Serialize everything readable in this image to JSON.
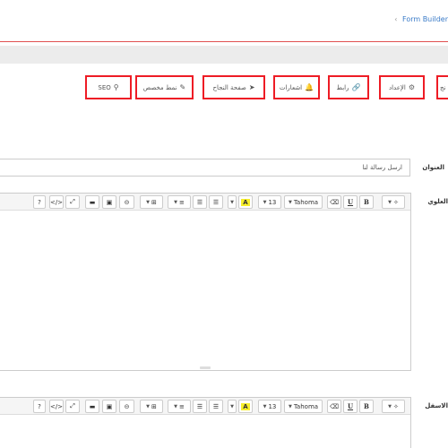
{
  "breadcrumb": {
    "separator": "‹",
    "link": "Form Builder"
  },
  "tabs": [
    {
      "key": "seo",
      "label": "SEO",
      "icon": "search-icon",
      "glyph": "⚲"
    },
    {
      "key": "custom-style",
      "label": "نمط مخصص",
      "icon": "pencil-icon",
      "glyph": "✎"
    },
    {
      "key": "success-page",
      "label": "صفحة النجاح",
      "icon": "send-icon",
      "glyph": "➤"
    },
    {
      "key": "notifications",
      "label": "اشعارات",
      "icon": "bell-icon",
      "glyph": "🔔"
    },
    {
      "key": "link",
      "label": "رابط",
      "icon": "link-icon",
      "glyph": "🔗"
    },
    {
      "key": "settings",
      "label": "الإعداد",
      "icon": "gears-icon",
      "glyph": "⚙"
    },
    {
      "key": "cut",
      "label": "نج",
      "icon": "",
      "glyph": ""
    }
  ],
  "form": {
    "title_label": "العنوان",
    "title_value": "ارسل رسالة لنا",
    "top_label": "العلوي",
    "bottom_label": "الاسفل"
  },
  "toolbar": {
    "help": "?",
    "code": "</>",
    "fullscreen": "⤢",
    "video": "▬",
    "picture": "▣",
    "link": "⊝",
    "table": "⊞",
    "align": "≡",
    "ol": "☰",
    "ul": "☰",
    "highlight": "A",
    "font_size": "13",
    "font_name": "Tahoma",
    "eraser": "⌫",
    "underline": "U",
    "bold": "B",
    "magic": "✧",
    "caret": "▼"
  }
}
